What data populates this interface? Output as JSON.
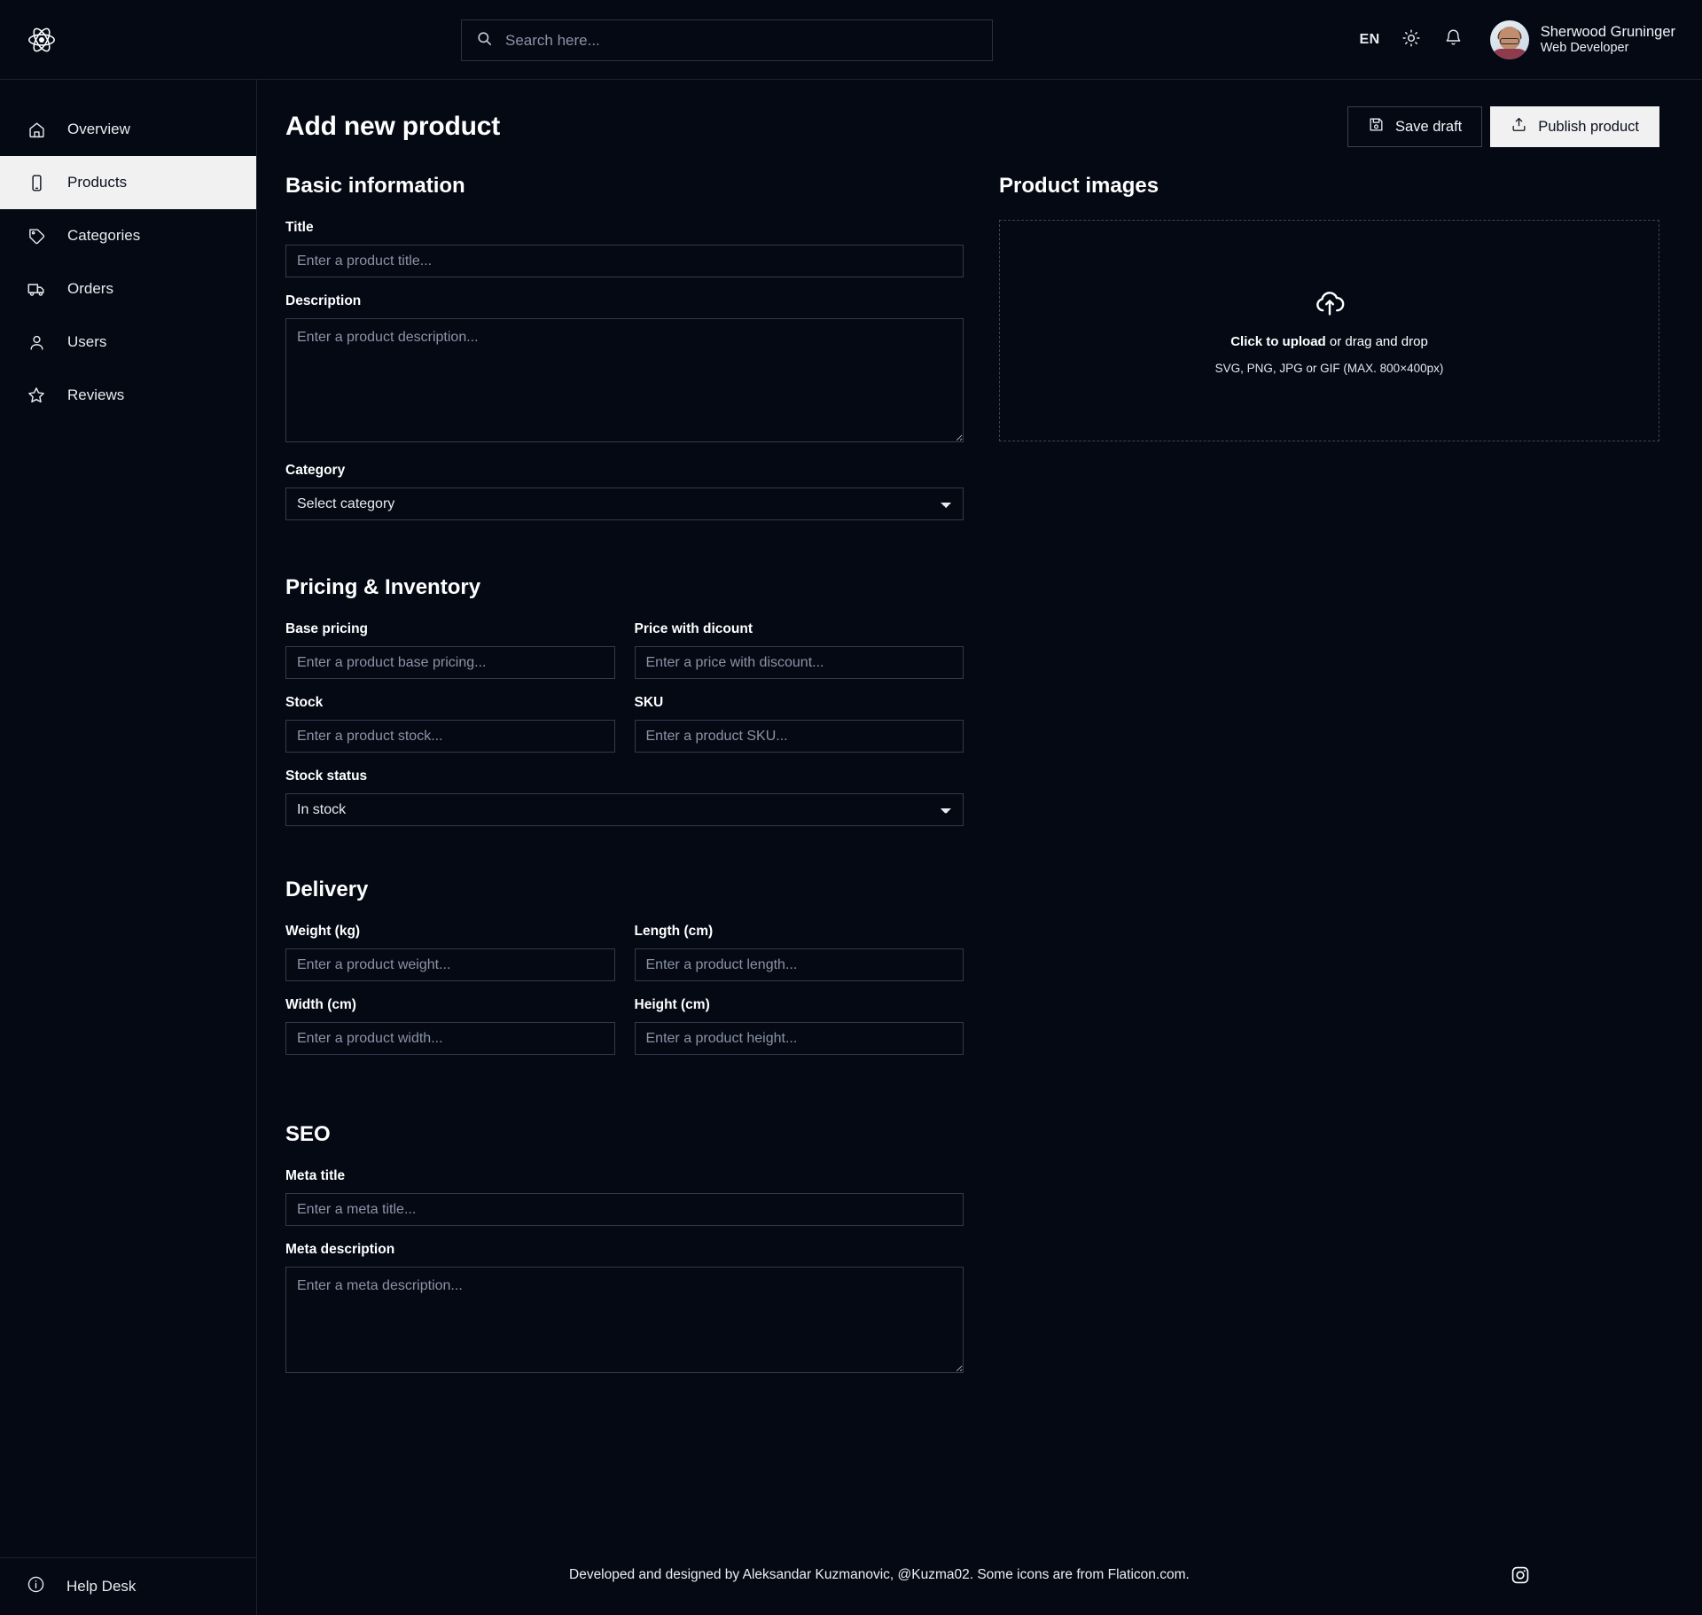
{
  "brand": {
    "logo_icon": "react-atom-logo"
  },
  "search": {
    "placeholder": "Search here...",
    "value": "",
    "icon": "search-icon"
  },
  "topbar": {
    "language": "EN",
    "theme_icon": "sun-icon",
    "notifications_icon": "bell-icon",
    "user": {
      "name": "Sherwood Gruninger",
      "role": "Web Developer",
      "avatar_icon": "avatar"
    }
  },
  "sidebar": {
    "items": [
      {
        "label": "Overview",
        "icon": "home-icon",
        "active": false
      },
      {
        "label": "Products",
        "icon": "phone-icon",
        "active": true
      },
      {
        "label": "Categories",
        "icon": "tag-icon",
        "active": false
      },
      {
        "label": "Orders",
        "icon": "truck-icon",
        "active": false
      },
      {
        "label": "Users",
        "icon": "user-icon",
        "active": false
      },
      {
        "label": "Reviews",
        "icon": "star-icon",
        "active": false
      }
    ],
    "help": {
      "label": "Help Desk",
      "icon": "info-circle-icon"
    }
  },
  "page": {
    "title": "Add new product",
    "save_draft": "Save draft",
    "save_draft_icon": "floppy-disk-icon",
    "publish": "Publish product",
    "publish_icon": "upload-tray-icon"
  },
  "basic": {
    "heading": "Basic information",
    "title_label": "Title",
    "title_placeholder": "Enter a product title...",
    "title_value": "",
    "description_label": "Description",
    "description_placeholder": "Enter a product description...",
    "description_value": "",
    "category_label": "Category",
    "category_selected": "Select category",
    "category_options": [
      "Select category"
    ]
  },
  "product_images": {
    "heading": "Product images",
    "upload_icon": "cloud-upload-icon",
    "cta_strong": "Click to upload",
    "cta_rest": " or drag and drop",
    "formats": "SVG, PNG, JPG or GIF (MAX. 800×400px)"
  },
  "pricing": {
    "heading": "Pricing & Inventory",
    "base_label": "Base pricing",
    "base_placeholder": "Enter a product base pricing...",
    "base_value": "",
    "discount_label": "Price with dicount",
    "discount_placeholder": "Enter a price with discount...",
    "discount_value": "",
    "stock_label": "Stock",
    "stock_placeholder": "Enter a product stock...",
    "stock_value": "",
    "sku_label": "SKU",
    "sku_placeholder": "Enter a product SKU...",
    "sku_value": "",
    "stock_status_label": "Stock status",
    "stock_status_selected": "In stock",
    "stock_status_options": [
      "In stock"
    ]
  },
  "delivery": {
    "heading": "Delivery",
    "weight_label": "Weight (kg)",
    "weight_placeholder": "Enter a product weight...",
    "weight_value": "",
    "length_label": "Length (cm)",
    "length_placeholder": "Enter a product length...",
    "length_value": "",
    "width_label": "Width (cm)",
    "width_placeholder": "Enter a product width...",
    "width_value": "",
    "height_label": "Height (cm)",
    "height_placeholder": "Enter a product height...",
    "height_value": ""
  },
  "seo": {
    "heading": "SEO",
    "meta_title_label": "Meta title",
    "meta_title_placeholder": "Enter a meta title...",
    "meta_title_value": "",
    "meta_desc_label": "Meta description",
    "meta_desc_placeholder": "Enter a meta description...",
    "meta_desc_value": ""
  },
  "footer": {
    "text": "Developed and designed by Aleksandar Kuzmanovic, @Kuzma02. Some icons are from Flaticon.com.",
    "social": [
      "facebook-icon",
      "instagram-icon",
      "twitter-icon",
      "github-icon",
      "youtube-icon"
    ]
  },
  "colors": {
    "background": "#040914",
    "border": "#2a3142",
    "accent_light": "#f1f1f1",
    "text": "#e8eaed",
    "placeholder": "#8b93a5"
  }
}
